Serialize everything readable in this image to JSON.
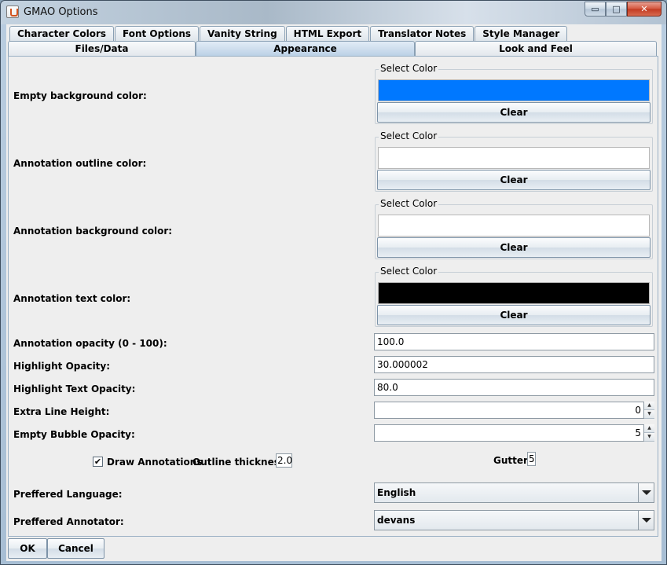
{
  "window": {
    "title": "GMAO Options"
  },
  "window_controls": {
    "minimize": "▭",
    "maximize": "□",
    "close": "✕"
  },
  "tabs_row1": [
    "Character Colors",
    "Font Options",
    "Vanity String",
    "HTML Export",
    "Translator Notes",
    "Style Manager"
  ],
  "tabs_row2": [
    "Files/Data",
    "Appearance",
    "Look and Feel"
  ],
  "active_tab": "Appearance",
  "color_settings": [
    {
      "label": "Empty background color:",
      "group_title": "Select Color",
      "color": "#0078ff",
      "clear": "Clear"
    },
    {
      "label": "Annotation outline color:",
      "group_title": "Select Color",
      "color": "#ffffff",
      "clear": "Clear"
    },
    {
      "label": "Annotation background color:",
      "group_title": "Select Color",
      "color": "#ffffff",
      "clear": "Clear"
    },
    {
      "label": "Annotation text color:",
      "group_title": "Select Color",
      "color": "#000000",
      "clear": "Clear"
    }
  ],
  "opacity_fields": [
    {
      "label": "Annotation opacity (0 - 100):",
      "value": "100.0"
    },
    {
      "label": "Highlight Opacity:",
      "value": "30.000002"
    },
    {
      "label": "Highlight Text Opacity:",
      "value": "80.0"
    }
  ],
  "spinners": [
    {
      "label": "Extra Line Height:",
      "value": "0"
    },
    {
      "label": "Empty Bubble Opacity:",
      "value": "5"
    }
  ],
  "draw_annotations": {
    "label": "Draw Annotations",
    "checked": true,
    "mark": "✔"
  },
  "outline_thickness": {
    "label": "Outline thickness:",
    "value": "2.0"
  },
  "gutter": {
    "label": "Gutter:",
    "value": "5"
  },
  "language": {
    "label": "Preffered Language:",
    "value": "English"
  },
  "annotator": {
    "label": "Preffered Annotator:",
    "value": "devans"
  },
  "buttons": {
    "ok": "OK",
    "cancel": "Cancel"
  }
}
